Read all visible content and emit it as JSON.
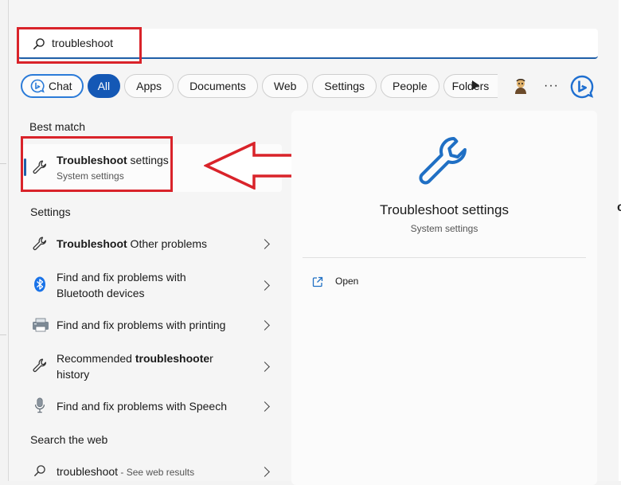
{
  "search": {
    "query": "troubleshoot"
  },
  "filters": {
    "chat_label": "Chat",
    "all_label": "All",
    "apps_label": "Apps",
    "documents_label": "Documents",
    "web_label": "Web",
    "settings_label": "Settings",
    "people_label": "People",
    "folders_label": "Folders",
    "more_label": "···"
  },
  "best_match": {
    "section_title": "Best match",
    "title_bold": "Troubleshoot",
    "title_rest": " settings",
    "subtitle": "System settings"
  },
  "settings_section": {
    "title": "Settings",
    "items": [
      {
        "bold": "Troubleshoot",
        "rest": " Other problems",
        "icon": "wrench-icon"
      },
      {
        "line1": "Find and fix problems with",
        "line2": "Bluetooth devices",
        "icon": "bluetooth-icon"
      },
      {
        "text": "Find and fix problems with printing",
        "icon": "printer-icon"
      },
      {
        "line1_pre": "Recommended ",
        "line1_bold": "troubleshoote",
        "line1_post": "r",
        "line2": "history",
        "icon": "wrench-icon"
      },
      {
        "text": "Find and fix problems with Speech",
        "icon": "microphone-icon"
      }
    ]
  },
  "web_section": {
    "title": "Search the web",
    "query": "troubleshoot",
    "hint": " - See web results",
    "icon": "search-icon"
  },
  "preview": {
    "title": "Troubleshoot settings",
    "subtitle": "System settings",
    "open_label": "Open",
    "icon": "wrench-icon"
  },
  "colors": {
    "accent": "#1458b5",
    "highlight": "#d9232a"
  }
}
